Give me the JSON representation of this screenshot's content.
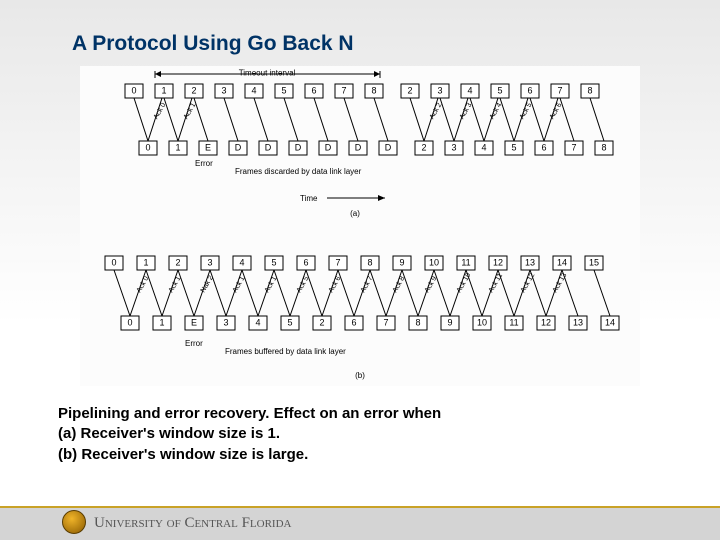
{
  "title": "A Protocol Using Go Back N",
  "caption": {
    "line1": "Pipelining and error recovery.  Effect on an error when",
    "line2": "(a) Receiver's window size is 1.",
    "line3": "(b) Receiver's window size is large."
  },
  "footer": {
    "university": "University of Central Florida"
  },
  "chart_data": [
    {
      "type": "diagram",
      "id": "a",
      "title": "Timeout interval",
      "sender_sequence": [
        0,
        1,
        2,
        3,
        4,
        5,
        6,
        7,
        8,
        2,
        3,
        4,
        5,
        6,
        7,
        8
      ],
      "receiver_sequence": [
        0,
        1,
        "E",
        "D",
        "D",
        "D",
        "D",
        "D",
        "D",
        2,
        3,
        4,
        5,
        6,
        7,
        8
      ],
      "error_index": 2,
      "discarded_label": "Frames discarded by data link layer",
      "time_label": "Time",
      "sublabel": "(a)",
      "acks_first_run": [
        0,
        1
      ],
      "acks_second_run": [
        2,
        3,
        4,
        5,
        6
      ]
    },
    {
      "type": "diagram",
      "id": "b",
      "sender_sequence": [
        0,
        1,
        2,
        3,
        4,
        5,
        6,
        7,
        8,
        9,
        10,
        11,
        12,
        13,
        14,
        15
      ],
      "receiver_sequence": [
        0,
        1,
        "E",
        3,
        4,
        5,
        2,
        6,
        7,
        8,
        9,
        10,
        11,
        12,
        13,
        14
      ],
      "error_index": 2,
      "buffered_label": "Frames buffered by data link layer",
      "sublabel": "(b)",
      "acks": [
        0,
        1
      ],
      "naks": [
        2
      ],
      "acks_after": [
        1,
        1,
        5,
        6,
        7,
        8,
        9,
        10,
        11,
        12,
        13
      ]
    }
  ]
}
